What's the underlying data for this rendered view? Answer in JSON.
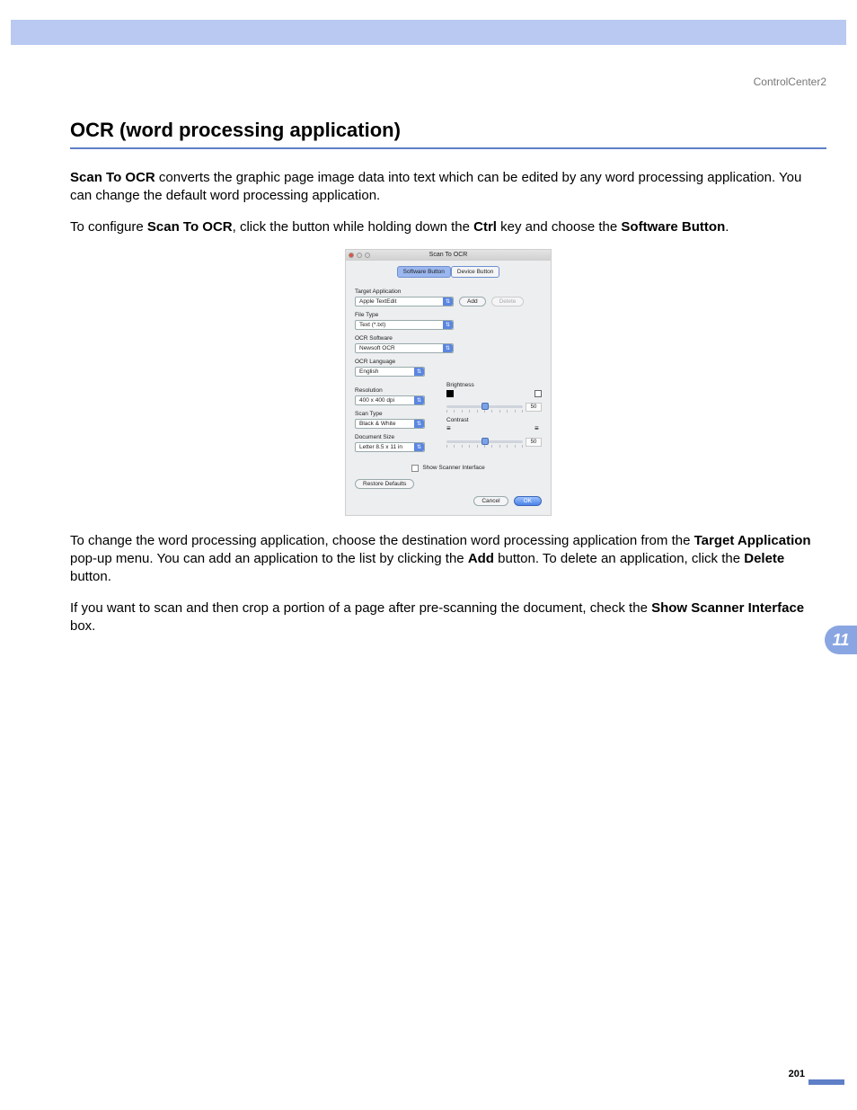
{
  "header_label": "ControlCenter2",
  "section_title": "OCR (word processing application)",
  "p1": {
    "lead": "Scan To OCR",
    "rest": " converts the graphic page image data into text which can be edited by any word processing application. You can change the default word processing application."
  },
  "p2": {
    "a": "To configure ",
    "b": "Scan To OCR",
    "c": ", click the button while holding down the ",
    "d": "Ctrl",
    "e": " key and choose the ",
    "f": "Software Button",
    "g": "."
  },
  "dialog": {
    "title": "Scan To OCR",
    "tabs": {
      "software": "Software Button",
      "device": "Device Button"
    },
    "labels": {
      "target_app": "Target Application",
      "file_type": "File Type",
      "ocr_software": "OCR Software",
      "ocr_language": "OCR Language",
      "resolution": "Resolution",
      "scan_type": "Scan Type",
      "document_size": "Document Size",
      "brightness": "Brightness",
      "contrast": "Contrast",
      "show_scanner_interface": "Show Scanner Interface"
    },
    "values": {
      "target_app": "Apple TextEdit",
      "file_type": "Text (*.txt)",
      "ocr_software": "Newsoft OCR",
      "ocr_language": "English",
      "resolution": "400 x 400 dpi",
      "scan_type": "Black & White",
      "document_size": "Letter 8.5 x 11 in",
      "brightness": "50",
      "contrast": "50"
    },
    "buttons": {
      "add": "Add",
      "delete": "Delete",
      "restore": "Restore Defaults",
      "cancel": "Cancel",
      "ok": "OK"
    }
  },
  "p3": {
    "a": "To change the word processing application, choose the destination word processing application from the ",
    "b": "Target Application",
    "c": " pop-up menu. You can add an application to the list by clicking the ",
    "d": "Add",
    "e": " button. To delete an application, click the ",
    "f": "Delete",
    "g": " button."
  },
  "p4": {
    "a": "If you want to scan and then crop a portion of a page after pre-scanning the document, check the ",
    "b": "Show Scanner Interface",
    "c": " box."
  },
  "side_tab": "11",
  "page_number": "201"
}
